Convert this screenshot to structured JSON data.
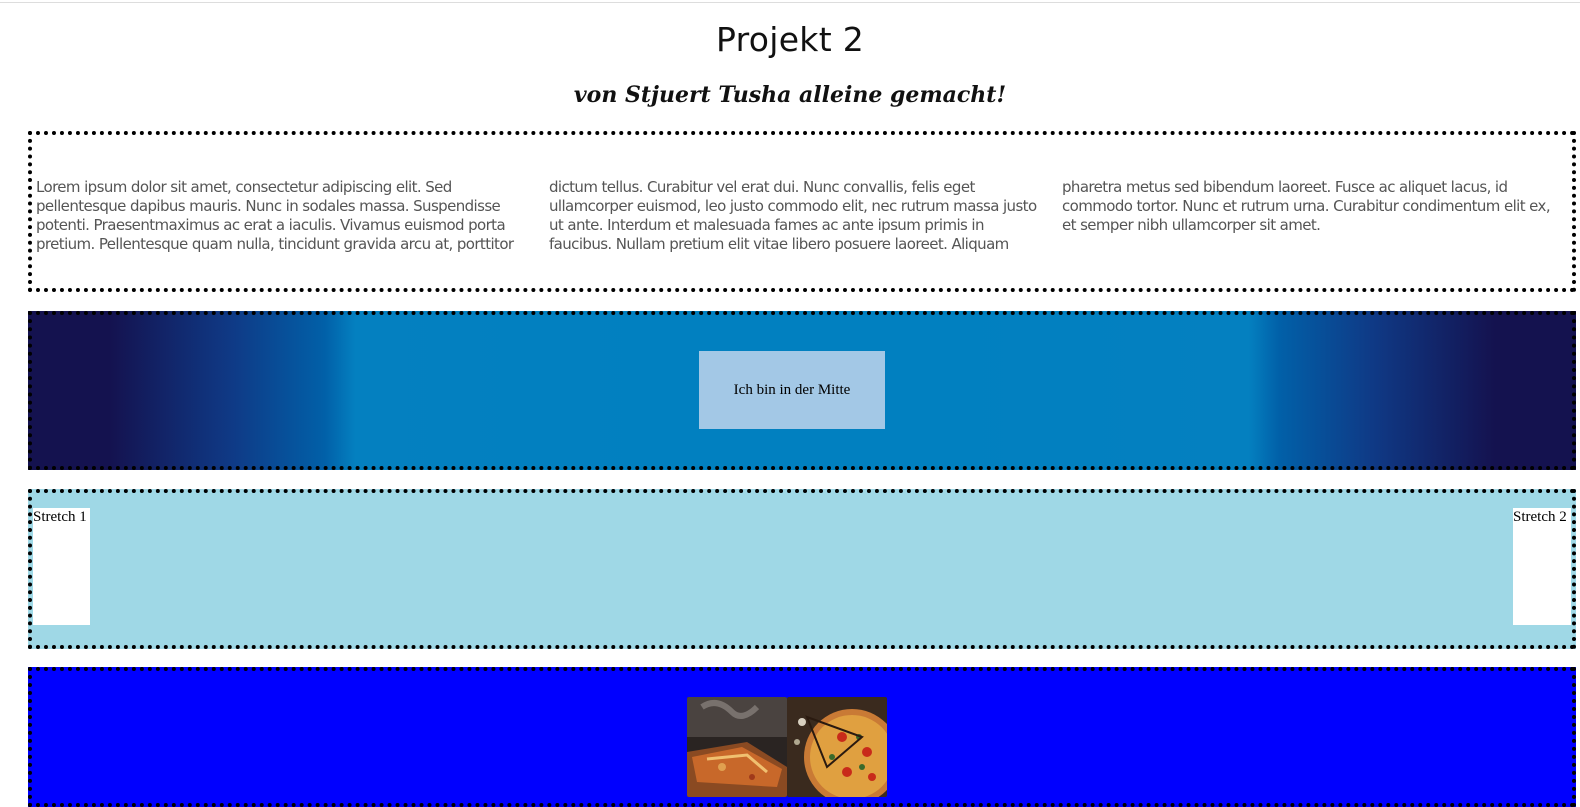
{
  "header": {
    "title": "Projekt 2",
    "subtitle": "von Stjuert Tusha alleine gemacht!"
  },
  "section1": {
    "columns": [
      "Lorem ipsum dolor sit amet, consectetur adipiscing elit. Sed pellentesque dapibus mauris. Nunc in sodales massa. Suspendisse potenti. Praesentmaximus ac erat a iaculis. Vivamus euismod porta pretium. Pellentesque quam nulla, tincidunt gravida arcu at, porttitor",
      "dictum tellus. Curabitur vel erat dui. Nunc convallis, felis eget ullamcorper euismod, leo justo commodo elit, nec rutrum massa justo ut ante. Interdum et malesuada fames ac ante ipsum primis in faucibus. Nullam pretium elit vitae libero posuere laoreet. Aliquam",
      "pharetra metus sed bibendum laoreet. Fusce ac aliquet lacus, id commodo tortor. Nunc et rutrum urna. Curabitur condimentum elit ex, et semper nibh ullamcorper sit amet."
    ]
  },
  "section2": {
    "center_text": "Ich bin in der Mitte",
    "gradient_colors": [
      "#14124f",
      "#0180c0"
    ]
  },
  "section3": {
    "stretch1": "Stretch 1",
    "stretch2": "Stretch 2",
    "background": "#9fd8e6"
  },
  "section4": {
    "background": "#0000ff",
    "images": [
      "pizza-photo-1",
      "pizza-photo-2"
    ]
  }
}
